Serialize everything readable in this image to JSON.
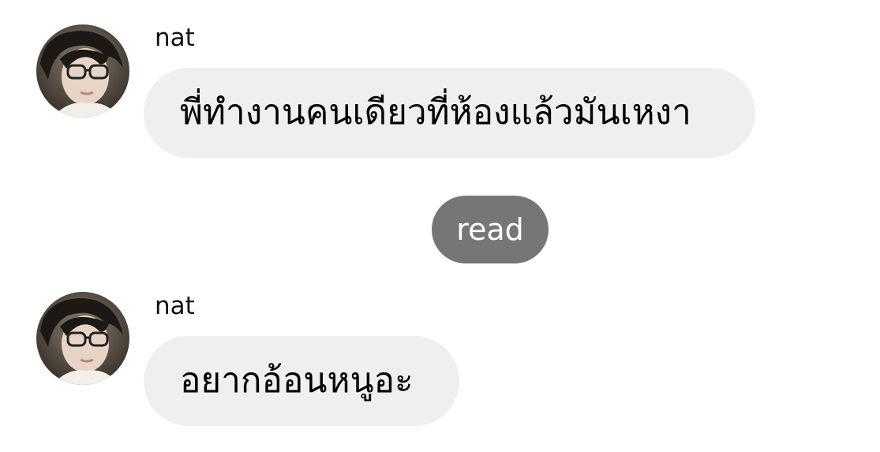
{
  "colors": {
    "bubble": "#efefef",
    "read_pill": "#767676",
    "read_text": "#ffffff",
    "sender_text": "#111111"
  },
  "messages": [
    {
      "sender": "nat",
      "text": "พี่ทำงานคนเดียวที่ห้องแล้วมันเหงา"
    },
    {
      "sender": "nat",
      "text": "อยากอ้อนหนูอะ"
    }
  ],
  "read_receipt": {
    "label": "read"
  },
  "icons": {
    "avatar": "profile-photo"
  }
}
